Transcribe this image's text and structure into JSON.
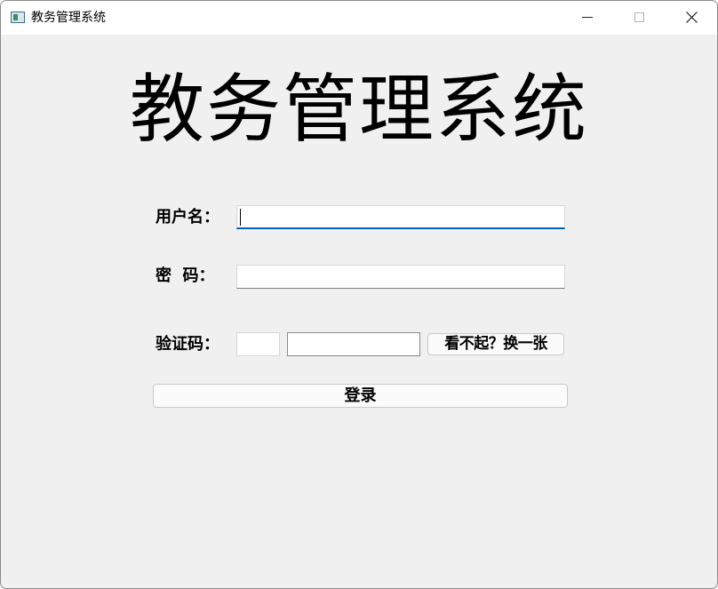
{
  "window": {
    "title": "教务管理系统",
    "controls": [
      "minimize-icon",
      "maximize-icon",
      "close-icon"
    ]
  },
  "main": {
    "heading": "教务管理系统"
  },
  "form": {
    "username_label": "用户名：",
    "username_value": "",
    "password_label": "密  码：",
    "password_value": "",
    "captcha_label": "验证码：",
    "captcha_image_text": "",
    "captcha_value": "",
    "refresh_label": "看不起？换一张",
    "login_label": "登录"
  },
  "colors": {
    "window_bg": "#f0f0f0",
    "titlebar_bg": "#ffffff",
    "focus_accent": "#005fb8"
  }
}
